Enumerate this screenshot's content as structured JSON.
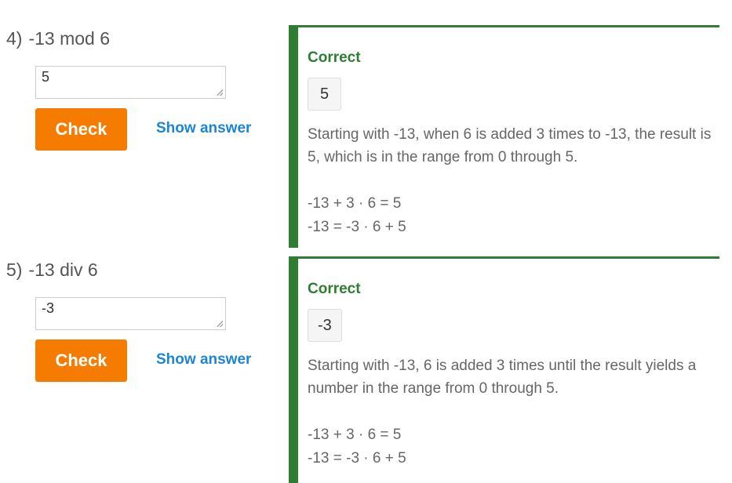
{
  "questions": [
    {
      "number": "4)",
      "prompt": "-13 mod 6",
      "answer_value": "5",
      "check_label": "Check",
      "show_answer_label": "Show answer",
      "feedback": {
        "status": "Correct",
        "answer": "5",
        "explanation": "Starting with -13, when 6 is added 3 times to -13, the result is 5, which is in the range from 0 through 5.",
        "equations": [
          "-13 + 3 · 6 = 5",
          "-13 = -3 · 6 + 5"
        ]
      }
    },
    {
      "number": "5)",
      "prompt": "-13 div 6",
      "answer_value": "-3",
      "check_label": "Check",
      "show_answer_label": "Show answer",
      "feedback": {
        "status": "Correct",
        "answer": "-3",
        "explanation": "Starting with -13, 6 is added 3 times until the result yields a number in the range from 0 through 5.",
        "equations": [
          "-13 + 3 · 6 = 5",
          "-13 = -3 · 6 + 5"
        ]
      }
    }
  ],
  "colors": {
    "check_button": "#f57c00",
    "show_answer_link": "#1b85d6",
    "correct_green": "#2e7d32"
  }
}
